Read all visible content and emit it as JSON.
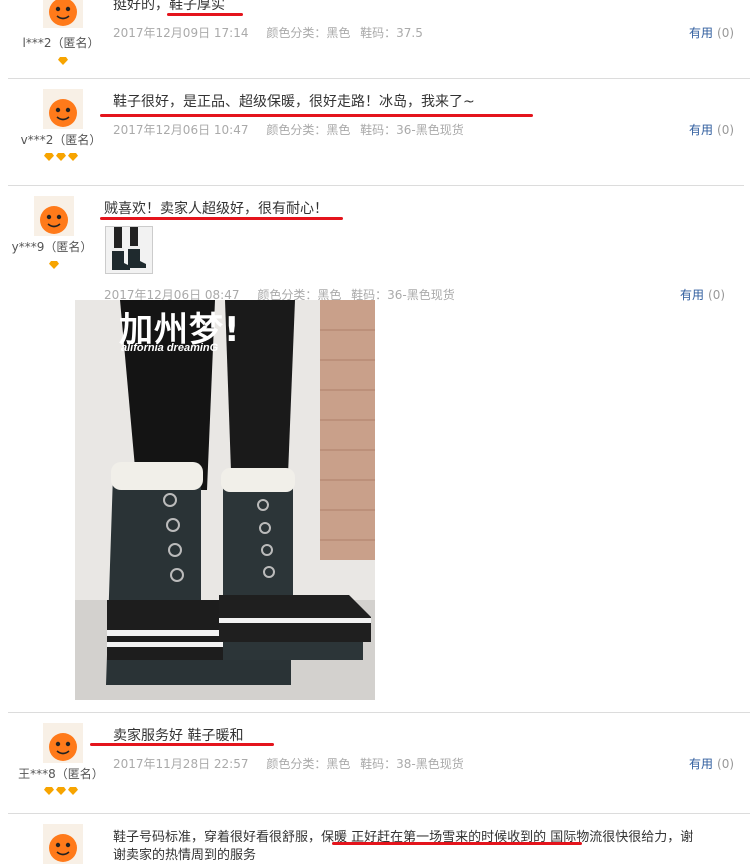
{
  "badge_color": "#f7a400",
  "accent_red": "#e4141c",
  "link_color": "#2f5d9e",
  "reviews": [
    {
      "user": "l***2（匿名）",
      "content": "挺好的，鞋子厚实",
      "date": "2017年12月09日 17:14",
      "color": "颜色分类：黑色",
      "size": "鞋码：37.5",
      "useful_label": "有用",
      "useful_count": "(0)",
      "badge_count": 1
    },
    {
      "user": "v***2（匿名）",
      "content": "鞋子很好，是正品、超级保暖，很好走路！冰岛，我来了~",
      "date": "2017年12月06日 10:47",
      "color": "颜色分类：黑色",
      "size": "鞋码：36-黑色现货",
      "useful_label": "有用",
      "useful_count": "(0)",
      "badge_count": 3
    },
    {
      "user": "y***9（匿名）",
      "content": "贼喜欢！卖家人超级好，很有耐心！",
      "date": "2017年12月06日 08:47",
      "color": "颜色分类：黑色",
      "size": "鞋码：36-黑色现货",
      "useful_label": "有用",
      "useful_count": "(0)",
      "badge_count": 1,
      "photo_text": "加州梦!",
      "photo_subtext": "alifornia dreaminG"
    },
    {
      "user": "王***8（匿名）",
      "content": "卖家服务好 鞋子暖和",
      "date": "2017年11月28日 22:57",
      "color": "颜色分类：黑色",
      "size": "鞋码：38-黑色现货",
      "useful_label": "有用",
      "useful_count": "(0)",
      "badge_count": 3
    },
    {
      "content_a": "鞋子号码标准，穿着很好看很舒服，",
      "content_b": "保暖 正好赶在第一场雪来的时候收到的",
      "content_c": " 国际物流很快很给力，谢",
      "content_line2": "谢卖家的热情周到的服务"
    }
  ]
}
